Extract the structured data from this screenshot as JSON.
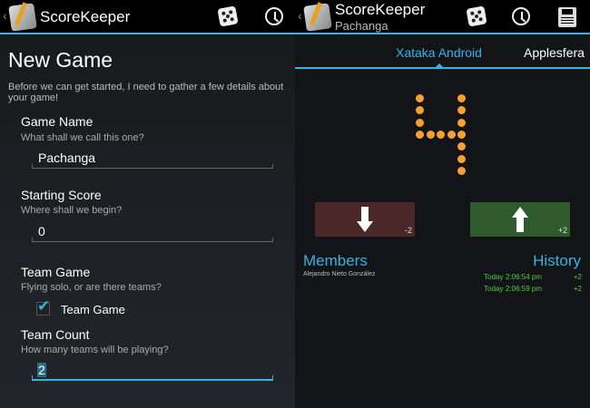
{
  "app": {
    "title": "ScoreKeeper",
    "accent": "#33b5e5"
  },
  "left": {
    "page_title": "New Game",
    "intro": "Before we can get started, I need to gather a few details about your game!",
    "game_name": {
      "label": "Game Name",
      "hint": "What shall we call this one?",
      "value": "Pachanga"
    },
    "starting_score": {
      "label": "Starting Score",
      "hint": "Where shall we begin?",
      "value": "0"
    },
    "team_game": {
      "label": "Team Game",
      "hint": "Flying solo, or are there teams?",
      "checkbox_label": "Team Game",
      "checked": true
    },
    "team_count": {
      "label": "Team Count",
      "hint": "How many teams will be playing?",
      "value": "2"
    }
  },
  "right": {
    "subtitle": "Pachanga",
    "tabs": [
      {
        "label": "Xataka Android",
        "active": true
      },
      {
        "label": "Applesfera",
        "active": false
      }
    ],
    "score": 4,
    "score_color": "#f5a030",
    "minus_button": {
      "value": "-2",
      "icon": "arrow-down-icon"
    },
    "plus_button": {
      "value": "+2",
      "icon": "arrow-up-icon"
    },
    "members_title": "Members",
    "members": [
      "Alejandro Nieto González"
    ],
    "history_title": "History",
    "history": [
      {
        "day": "Today",
        "time": "2:06:54 pm",
        "delta": "+2"
      },
      {
        "day": "Today",
        "time": "2:06:59 pm",
        "delta": "+2"
      }
    ]
  }
}
